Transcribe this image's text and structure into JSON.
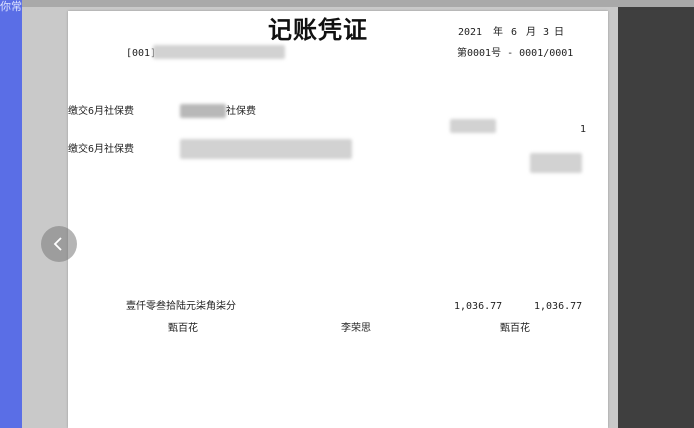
{
  "corner_label": "你常",
  "voucher": {
    "title": "记账凭证",
    "date_year": "2021",
    "date_month_label": "年",
    "date_month": "6",
    "date_day_label": "月",
    "date_day": "3",
    "date_suffix": "日",
    "org_code_prefix": "[001]",
    "voucher_number": "第0001号 - 0001/0001",
    "entries": [
      {
        "summary": "缴交6月社保费",
        "account_suffix": "社保费",
        "amount": "1"
      },
      {
        "summary": "缴交6月社保费",
        "account_suffix": "",
        "amount": ""
      }
    ],
    "total_in_words": "壹仟零叁拾陆元柒角柒分",
    "total_debit": "1,036.77",
    "total_credit": "1,036.77",
    "signer_accountant": "甄百花",
    "signer_reviewer": "李荣思",
    "signer_maker": "甄百花"
  },
  "icons": {
    "prev": "chevron-left-icon"
  }
}
